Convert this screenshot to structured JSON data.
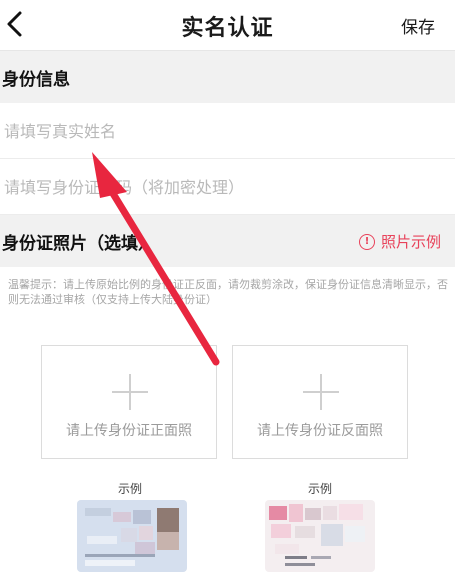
{
  "header": {
    "title": "实名认证",
    "save_label": "保存"
  },
  "identity_section": {
    "title": "身份信息",
    "name_placeholder": "请填写真实姓名",
    "id_placeholder": "请填写身份证号码（将加密处理）"
  },
  "photo_section": {
    "title": "身份证照片（选填）",
    "sample_link": "照片示例",
    "notice": "温馨提示：请上传原始比例的身份证正反面，请勿裁剪涂改，保证身份证信息清晰显示，否则无法通过审核（仅支持上传大陆身份证）",
    "front_upload_label": "请上传身份证正面照",
    "back_upload_label": "请上传身份证反面照",
    "example_front_label": "示例",
    "example_back_label": "示例"
  },
  "colors": {
    "accent": "#e8425a",
    "arrow": "#e8263f"
  },
  "icons": [
    "chevron-left-icon",
    "warning-circle-icon",
    "plus-icon",
    "annotation-arrow"
  ]
}
